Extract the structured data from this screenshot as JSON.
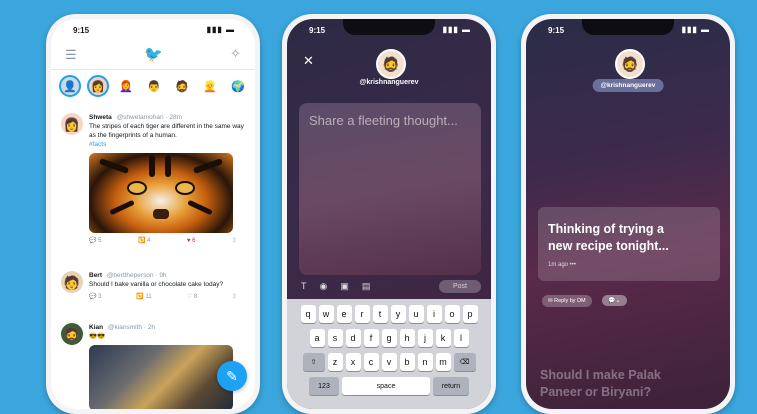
{
  "phone1": {
    "time": "9:15",
    "tweets": [
      {
        "name": "Shweta",
        "handle": "@shwetamohan · 28m",
        "text": "The stripes of each tiger are different in the same way as the fingerprints of a human.",
        "hashtag": "#facts",
        "replies": "5",
        "retweets": "4",
        "likes": "6"
      },
      {
        "name": "Bert",
        "handle": "@berttheperson · 9h",
        "text": "Should I bake vanilla or chocolate cake today?",
        "replies": "3",
        "retweets": "11",
        "likes": "8"
      },
      {
        "name": "Kian",
        "handle": "@kiansmith · 2h",
        "text": "😎😎"
      }
    ]
  },
  "phone2": {
    "time": "9:15",
    "username": "@krishnanguerev",
    "placeholder": "Share a fleeting thought...",
    "post_label": "Post",
    "keyboard": {
      "row1": [
        "q",
        "w",
        "e",
        "r",
        "t",
        "y",
        "u",
        "i",
        "o",
        "p"
      ],
      "row2": [
        "a",
        "s",
        "d",
        "f",
        "g",
        "h",
        "j",
        "k",
        "l"
      ],
      "row3": [
        "z",
        "x",
        "c",
        "v",
        "b",
        "n",
        "m"
      ],
      "num_label": "123",
      "space_label": "space",
      "return_label": "return"
    }
  },
  "phone3": {
    "time": "9:15",
    "username": "@krishnanguerev",
    "fleet_text": "Thinking of trying a\nnew recipe tonight...",
    "meta": "1m ago  •••",
    "reply_label": "Reply by DM",
    "next_fleet_text": "Should I make Palak\nPaneer or Biryani?"
  }
}
